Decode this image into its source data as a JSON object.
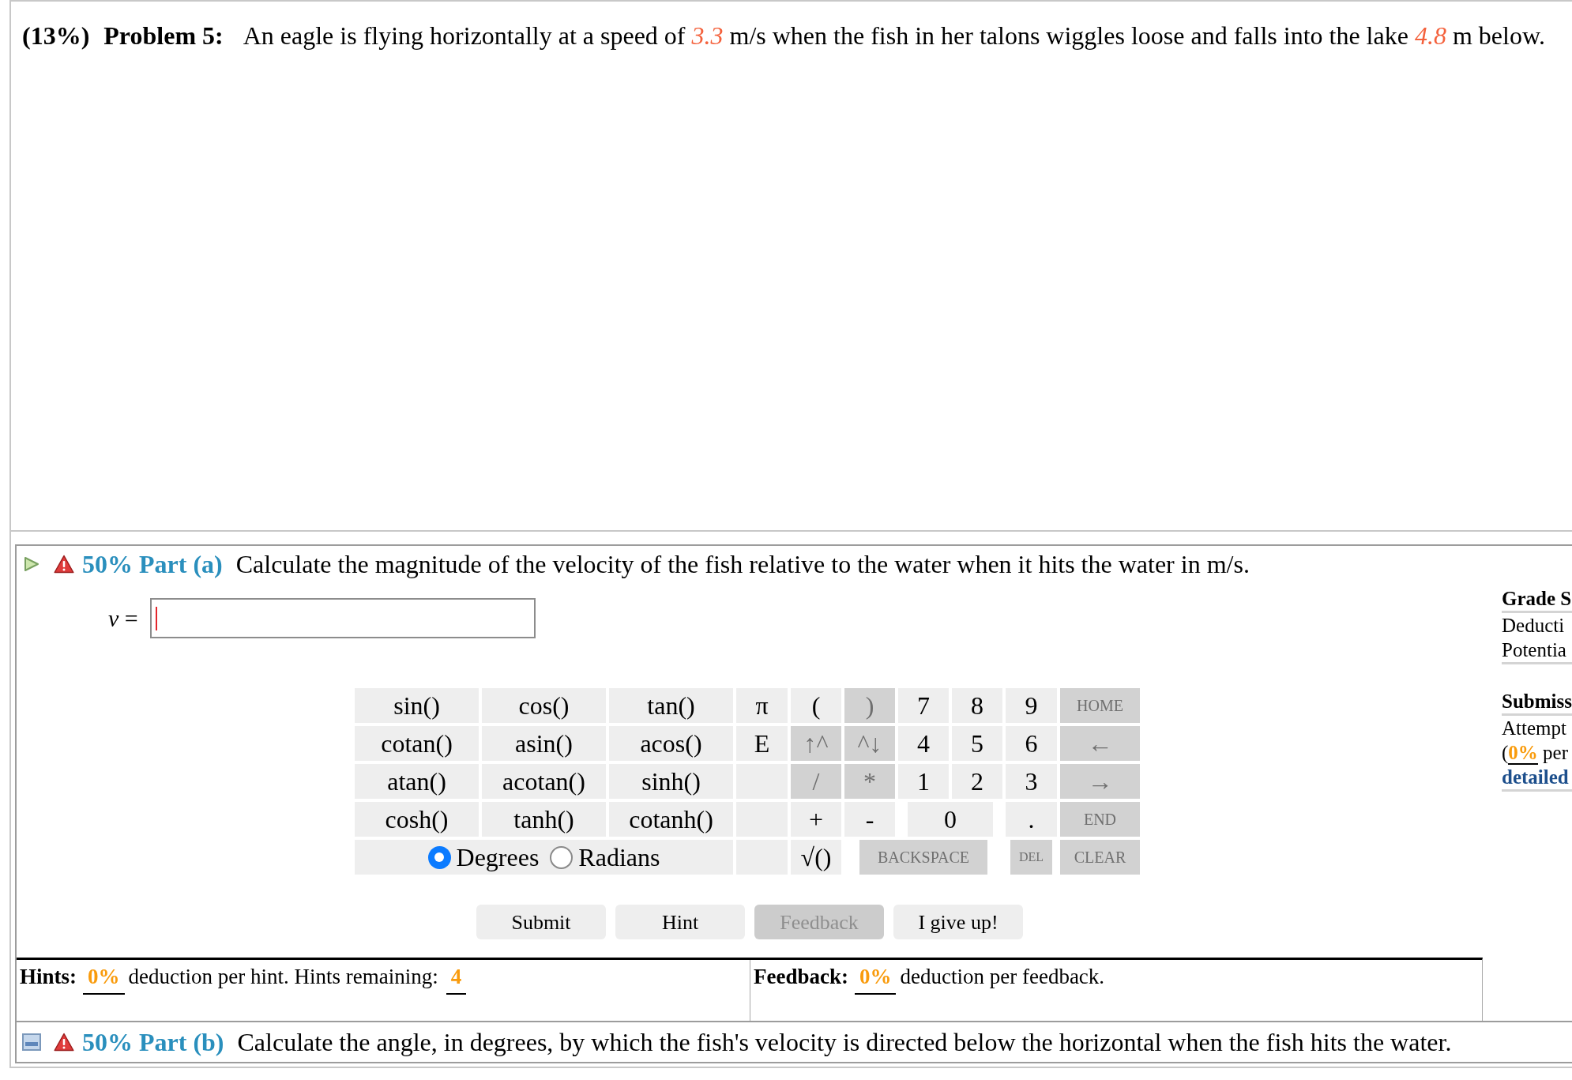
{
  "problem": {
    "weight": "(13%)",
    "title": "Problem 5:",
    "text": "An eagle is flying horizontally at a speed of *3.3* m/s when the fish in her talons wiggles loose and falls into the lake *4.8* m below."
  },
  "parts": [
    {
      "label": "50% Part (a)",
      "question": "Calculate the magnitude of the velocity of the fish relative to the water when it hits the water in m/s.",
      "open": true,
      "answer": {
        "label": "*v* =",
        "focused": true
      },
      "keypad": {
        "keys": [
          {
            "label": "sin()",
            "disabled": false
          },
          {
            "label": "cos()",
            "disabled": false
          },
          {
            "label": "tan()",
            "disabled": false
          },
          {
            "label": "π",
            "disabled": false
          },
          {
            "label": "(",
            "disabled": false
          },
          {
            "label": ")",
            "disabled": true
          },
          {
            "label": "7",
            "disabled": false
          },
          {
            "label": "8",
            "disabled": false
          },
          {
            "label": "9",
            "disabled": false
          },
          {
            "label": "HOME",
            "disabled": true
          },
          {
            "label": "cotan()",
            "disabled": false
          },
          {
            "label": "asin()",
            "disabled": false
          },
          {
            "label": "acos()",
            "disabled": false
          },
          {
            "label": "E",
            "disabled": false
          },
          {
            "label": "↑^",
            "disabled": true
          },
          {
            "label": "^↓",
            "disabled": true
          },
          {
            "label": "4",
            "disabled": false
          },
          {
            "label": "5",
            "disabled": false
          },
          {
            "label": "6",
            "disabled": false
          },
          {
            "label": "←",
            "disabled": true
          },
          {
            "label": "atan()",
            "disabled": false
          },
          {
            "label": "acotan()",
            "disabled": false
          },
          {
            "label": "sinh()",
            "disabled": false
          },
          {
            "label": "/",
            "disabled": true
          },
          {
            "label": "*",
            "disabled": true
          },
          {
            "label": "1",
            "disabled": false
          },
          {
            "label": "2",
            "disabled": false
          },
          {
            "label": "3",
            "disabled": false
          },
          {
            "label": "→",
            "disabled": true
          },
          {
            "label": "cosh()",
            "disabled": false
          },
          {
            "label": "tanh()",
            "disabled": false
          },
          {
            "label": "cotanh()",
            "disabled": false
          },
          {
            "label": "+",
            "disabled": false
          },
          {
            "label": "-",
            "disabled": false
          },
          {
            "label": "0",
            "disabled": false
          },
          {
            "label": ".",
            "disabled": false
          },
          {
            "label": "END",
            "disabled": true
          },
          {
            "label": "√()",
            "disabled": false
          },
          {
            "label": "BACKSPACE",
            "disabled": true
          },
          {
            "label": "DEL",
            "disabled": true
          },
          {
            "label": "CLEAR",
            "disabled": true
          }
        ],
        "angle_modes": [
          {
            "label": "Degrees",
            "selected": true
          },
          {
            "label": "Radians",
            "selected": false
          }
        ]
      },
      "buttons": [
        {
          "label": "Submit",
          "disabled": false
        },
        {
          "label": "Hint",
          "disabled": false
        },
        {
          "label": "Feedback",
          "disabled": true
        },
        {
          "label": "I give up!",
          "disabled": false
        }
      ],
      "hints": {
        "label": "Hints:",
        "deduction": "0%",
        "text": "deduction per hint. Hints remaining:",
        "remaining": "4"
      },
      "feedback": {
        "label": "Feedback:",
        "deduction": "0%",
        "text": "deduction per feedback."
      },
      "grade_summary": {
        "title": "Grade S",
        "lines": [
          "Deducti",
          "Potentia"
        ]
      },
      "submissions": {
        "title": "Submiss",
        "lines": [
          "Attempt"
        ],
        "rate_text": "(**0%** per",
        "link": "detailed"
      }
    },
    {
      "label": "50% Part (b)",
      "question": "Calculate the angle, in degrees, by which the fish's velocity is directed below the horizontal when the fish hits the water.",
      "open": false
    }
  ]
}
